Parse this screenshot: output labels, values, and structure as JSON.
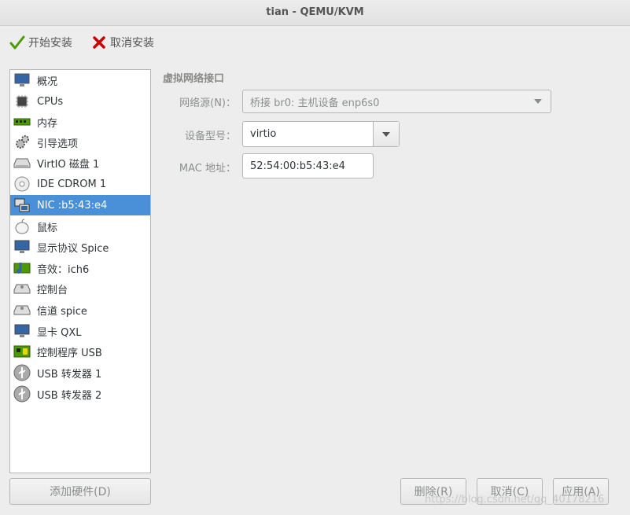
{
  "window": {
    "title": "tian - QEMU/KVM"
  },
  "toolbar": {
    "begin_install": "开始安装",
    "cancel_install": "取消安装"
  },
  "hardware_list": [
    {
      "label": "概况",
      "icon": "overview-monitor-icon"
    },
    {
      "label": "CPUs",
      "icon": "cpu-chip-icon"
    },
    {
      "label": "内存",
      "icon": "memory-module-icon"
    },
    {
      "label": "引导选项",
      "icon": "boot-gears-icon"
    },
    {
      "label": "VirtIO 磁盘 1",
      "icon": "hard-disk-icon"
    },
    {
      "label": "IDE CDROM 1",
      "icon": "cdrom-icon"
    },
    {
      "label": "NIC :b5:43:e4",
      "icon": "network-card-icon",
      "selected": true
    },
    {
      "label": "鼠标",
      "icon": "mouse-icon"
    },
    {
      "label": "显示协议 Spice",
      "icon": "display-monitor-icon"
    },
    {
      "label": "音效：ich6",
      "icon": "sound-card-icon"
    },
    {
      "label": "控制台",
      "icon": "console-serial-icon"
    },
    {
      "label": "信道 spice",
      "icon": "channel-serial-icon"
    },
    {
      "label": "显卡 QXL",
      "icon": "video-card-icon"
    },
    {
      "label": "控制程序 USB",
      "icon": "controller-board-icon"
    },
    {
      "label": "USB 转发器 1",
      "icon": "usb-redirector-icon"
    },
    {
      "label": "USB 转发器 2",
      "icon": "usb-redirector-icon"
    }
  ],
  "add_hardware_label": "添加硬件(D)",
  "nic": {
    "section_title": "虚拟网络接口",
    "network_source_label": "网络源(N)：",
    "network_source_value": "桥接 br0: 主机设备 enp6s0",
    "device_model_label": "设备型号：",
    "device_model_value": "virtio",
    "mac_label": "MAC 地址：",
    "mac_value": "52:54:00:b5:43:e4"
  },
  "buttons": {
    "remove": "删除(R)",
    "cancel": "取消(C)",
    "apply": "应用(A)"
  },
  "watermark": "https://blog.csdn.net/qq_40178216"
}
